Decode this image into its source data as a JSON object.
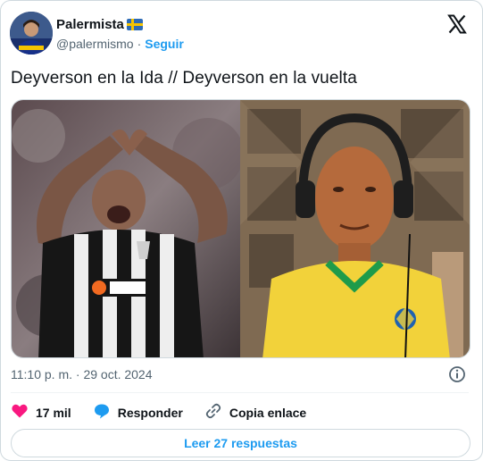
{
  "author": {
    "display_name": "Palermista",
    "handle": "@palermismo",
    "follow_label": "Seguir",
    "flag": "sweden-flag-icon"
  },
  "tweet": {
    "text": "Deyverson en la Ida // Deyverson en la vuelta",
    "timestamp": "11:10 p. m. · 29 oct. 2024"
  },
  "media": [
    {
      "name": "photo-player-heart-celebration"
    },
    {
      "name": "photo-old-man-headphones-brazil-shirt"
    }
  ],
  "actions": {
    "likes": "17 mil",
    "reply_label": "Responder",
    "copy_link_label": "Copia enlace"
  },
  "replies_button": "Leer 27 respuestas",
  "colors": {
    "accent": "#1d9bf0",
    "like": "#f91880",
    "text": "#0f1419",
    "muted": "#536471"
  }
}
